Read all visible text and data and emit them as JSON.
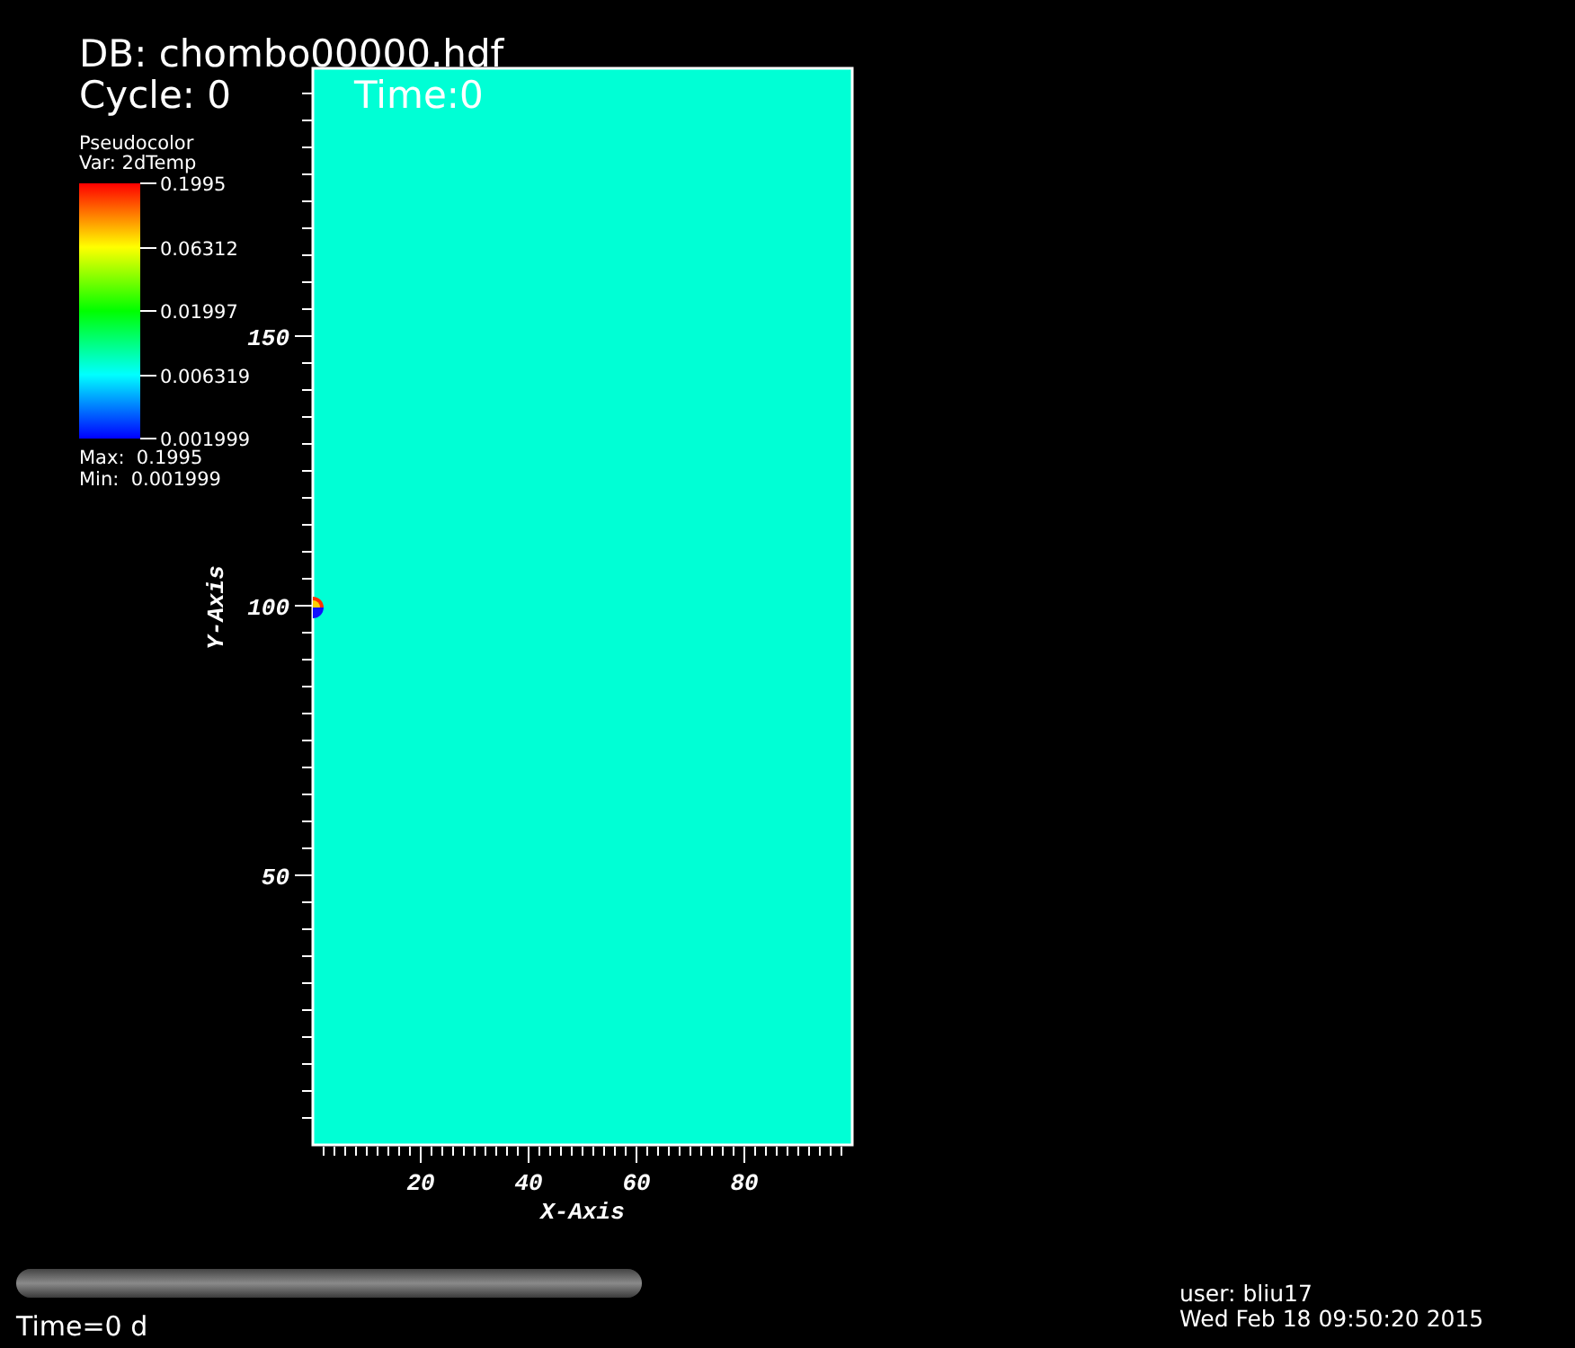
{
  "annotations": {
    "database": "DB: chombo00000.hdf",
    "cycle": "Cycle: 0",
    "time": "Time:0"
  },
  "legend": {
    "plot_type": "Pseudocolor",
    "variable": "Var: 2dTemp",
    "tick_labels": [
      "0.1995",
      "0.06312",
      "0.01997",
      "0.006319",
      "0.001999"
    ],
    "max": "Max:  0.1995",
    "min": "Min:  0.001999"
  },
  "plot": {
    "x_axis": {
      "title": "X-Axis",
      "tick_labels": [
        "20",
        "40",
        "60",
        "80"
      ]
    },
    "y_axis": {
      "title": "Y-Axis",
      "tick_labels": [
        "150",
        "100",
        "50"
      ]
    }
  },
  "time_slider": {
    "label": "Time=0 d",
    "level": 1
  },
  "user_info": {
    "user": "user: bliu17",
    "date": "Wed Feb 18 09:50:20 2015"
  }
}
